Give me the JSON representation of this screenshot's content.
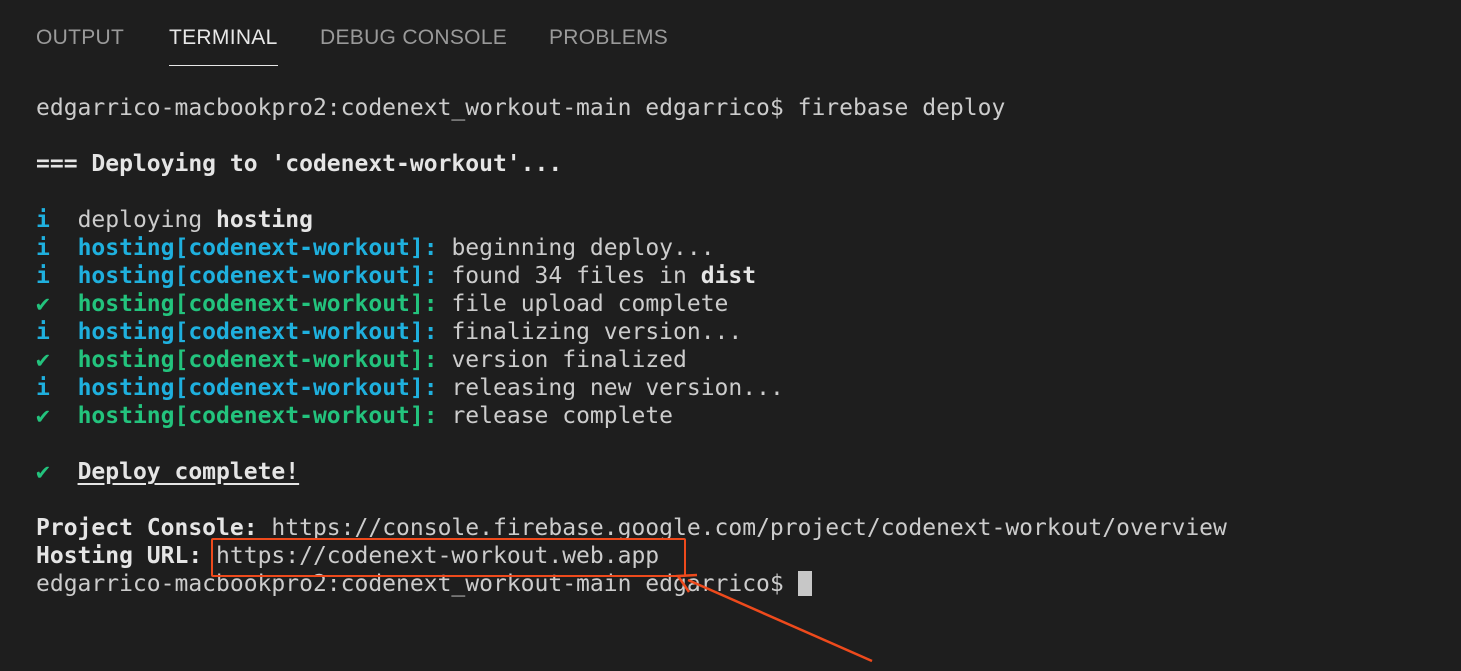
{
  "tabs": [
    {
      "label": "OUTPUT",
      "active": false
    },
    {
      "label": "TERMINAL",
      "active": true
    },
    {
      "label": "DEBUG CONSOLE",
      "active": false
    },
    {
      "label": "PROBLEMS",
      "active": false
    }
  ],
  "terminal": {
    "prompt": "edgarrico-macbookpro2:codenext_workout-main edgarrico$",
    "command": "firebase deploy",
    "deploying_header": "=== Deploying to 'codenext-workout'...",
    "line_deploying": {
      "icon": "i",
      "text": "deploying",
      "target": "hosting"
    },
    "hosting_prefix": "hosting[codenext-workout]:",
    "steps": [
      {
        "icon": "i",
        "status": "info",
        "message": "beginning deploy..."
      },
      {
        "icon": "i",
        "status": "info",
        "message": "found 34 files in",
        "bold_suffix": "dist"
      },
      {
        "icon": "✔",
        "status": "success",
        "message": "file upload complete"
      },
      {
        "icon": "i",
        "status": "info",
        "message": "finalizing version..."
      },
      {
        "icon": "✔",
        "status": "success",
        "message": "version finalized"
      },
      {
        "icon": "i",
        "status": "info",
        "message": "releasing new version..."
      },
      {
        "icon": "✔",
        "status": "success",
        "message": "release complete"
      }
    ],
    "deploy_complete": {
      "icon": "✔",
      "text": "Deploy complete!"
    },
    "project_console_label": "Project Console:",
    "project_console_url": "https://console.firebase.google.com/project/codenext-workout/overview",
    "hosting_url_label": "Hosting URL:",
    "hosting_url": "https://codenext-workout.web.app",
    "final_prompt": "edgarrico-macbookpro2:codenext_workout-main edgarrico$"
  },
  "colors": {
    "background": "#1e1e1e",
    "info": "#1fb0de",
    "success": "#23c37d",
    "annotation": "#ee4a1c"
  }
}
